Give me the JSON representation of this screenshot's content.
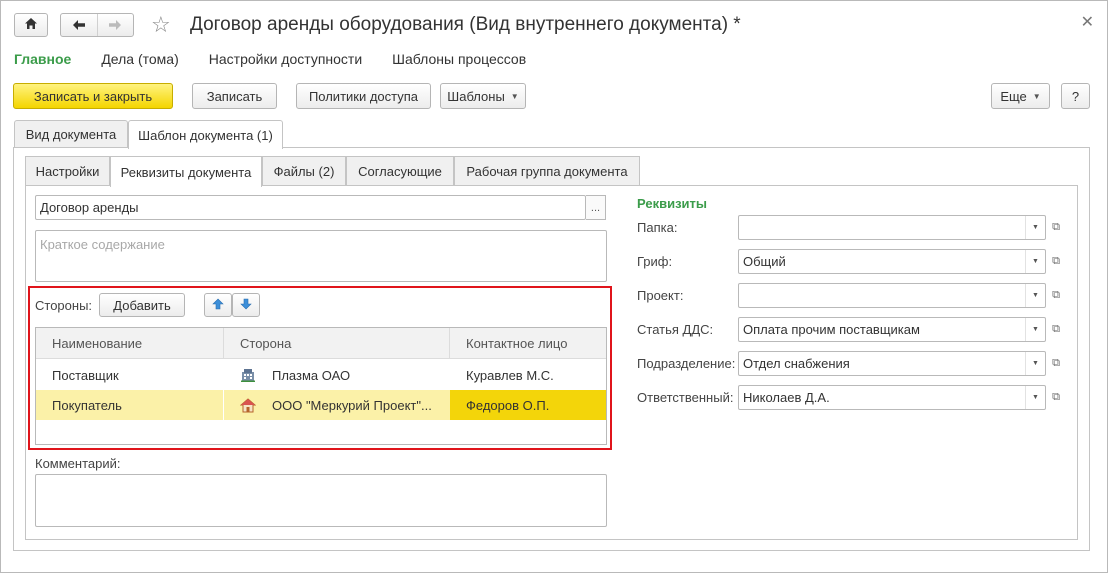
{
  "window": {
    "title": "Договор аренды оборудования (Вид внутреннего документа) *"
  },
  "icons": [
    "home-icon",
    "back-arrow-icon",
    "forward-arrow-icon",
    "favorite-star-icon",
    "close-icon",
    "arrow-up-icon",
    "arrow-down-icon",
    "building-icon",
    "house-icon",
    "dropdown-arrow-icon",
    "open-form-icon"
  ],
  "sections": [
    {
      "label": "Главное",
      "active": true
    },
    {
      "label": "Дела (тома)",
      "active": false
    },
    {
      "label": "Настройки доступности",
      "active": false
    },
    {
      "label": "Шаблоны процессов",
      "active": false
    }
  ],
  "toolbar": {
    "save_close": "Записать и закрыть",
    "save": "Записать",
    "access_policies": "Политики доступа",
    "templates": "Шаблоны",
    "more": "Еще",
    "help": "?"
  },
  "outer_tabs": [
    {
      "label": "Вид документа"
    },
    {
      "label": "Шаблон документа (1)"
    }
  ],
  "inner_tabs": [
    {
      "label": "Настройки"
    },
    {
      "label": "Реквизиты документа"
    },
    {
      "label": "Файлы (2)"
    },
    {
      "label": "Согласующие"
    },
    {
      "label": "Рабочая группа документа"
    }
  ],
  "form": {
    "name_value": "Договор аренды",
    "dots": "...",
    "summary_placeholder": "Краткое содержание",
    "parties_label": "Стороны:",
    "add_button": "Добавить",
    "comment_label": "Комментарий:"
  },
  "parties_table": {
    "columns": [
      "Наименование",
      "Сторона",
      "Контактное лицо"
    ],
    "rows": [
      {
        "name": "Поставщик",
        "party": "Плазма ОАО",
        "contact": "Куравлев М.С.",
        "selected": false
      },
      {
        "name": "Покупатель",
        "party": "ООО \"Меркурий Проект\"...",
        "contact": "Федоров О.П.",
        "selected": true
      }
    ]
  },
  "requisites": {
    "title": "Реквизиты",
    "fields": [
      {
        "label": "Папка:",
        "value": ""
      },
      {
        "label": "Гриф:",
        "value": "Общий"
      },
      {
        "label": "Проект:",
        "value": ""
      },
      {
        "label": "Статья ДДС:",
        "value": "Оплата прочим поставщикам"
      },
      {
        "label": "Подразделение:",
        "value": "Отдел снабжения"
      },
      {
        "label": "Ответственный:",
        "value": "Николаев Д.А."
      }
    ]
  },
  "colors": {
    "accent_green": "#3b9c4a",
    "primary_yellow": "#f4d500",
    "highlight_red": "#e0141b",
    "row_selected": "#fbf1a8",
    "cell_current": "#f3d50a"
  }
}
